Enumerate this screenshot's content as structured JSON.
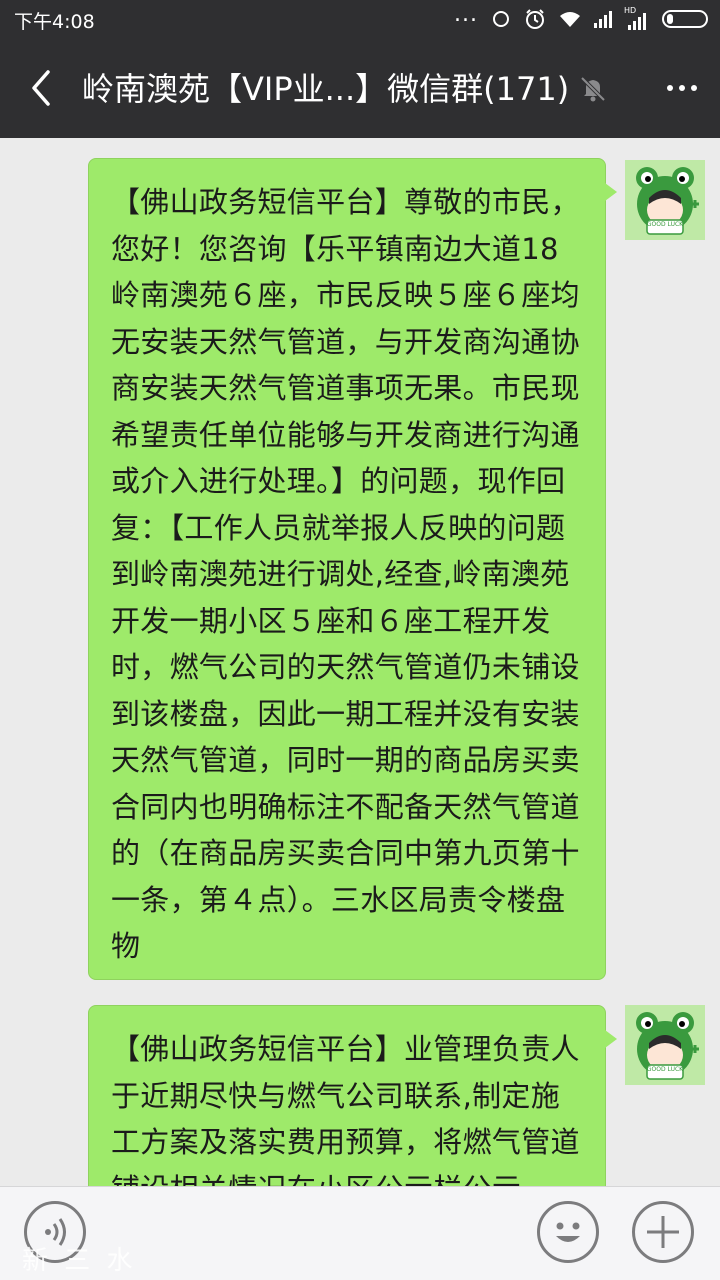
{
  "status_bar": {
    "time": "下午4:08",
    "dots": "...",
    "hd_label": "HD"
  },
  "header": {
    "back_icon": "chevron-left-icon",
    "title": "岭南澳苑【VIP业...】微信群(171)",
    "mute_icon": "bell-muted-icon",
    "more_icon": "more-dots-icon"
  },
  "messages": [
    {
      "sender": "self",
      "text": "【佛山政务短信平台】尊敬的市民，您好！您咨询【乐平镇南边大道18岭南澳苑６座，市民反映５座６座均无安装天然气管道，与开发商沟通协商安装天然气管道事项无果。市民现希望责任单位能够与开发商进行沟通或介入进行处理。】的问题，现作回复：【工作人员就举报人反映的问题到岭南澳苑进行调处,经查,岭南澳苑开发一期小区５座和６座工程开发时，燃气公司的天然气管道仍未铺设到该楼盘，因此一期工程并没有安装天然气管道，同时一期的商品房买卖合同内也明确标注不配备天然气管道的（在商品房买卖合同中第九页第十一条，第４点）。三水区局责令楼盘物",
      "avatar_text": "GOOD LUCK"
    },
    {
      "sender": "self",
      "text": "【佛山政务短信平台】业管理负责人于近期尽快与燃气公司联系,制定施工方案及落实费用预算，将燃气管道铺设相关情况在小区公示栏公示",
      "avatar_text": "GOOD LUCK"
    }
  ],
  "input_bar": {
    "voice_icon": "voice-icon",
    "emoji_icon": "emoji-icon",
    "plus_icon": "plus-icon"
  },
  "watermark": "新 三 水",
  "colors": {
    "bar_bg": "#2f2f31",
    "chat_bg": "#ebebeb",
    "bubble_green": "#9eea6a"
  }
}
